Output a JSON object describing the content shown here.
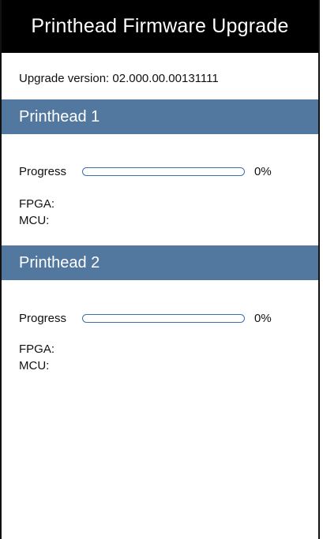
{
  "window": {
    "title": "Printhead Firmware Upgrade"
  },
  "upgrade": {
    "version_text": "Upgrade version: 02.000.00.00131111"
  },
  "printheads": [
    {
      "title": "Printhead 1",
      "progress_label": "Progress",
      "progress_value": 0,
      "progress_text": "0%",
      "fpga_label": "FPGA:",
      "mcu_label": "MCU:"
    },
    {
      "title": "Printhead 2",
      "progress_label": "Progress",
      "progress_value": 0,
      "progress_text": "0%",
      "fpga_label": "FPGA:",
      "mcu_label": "MCU:"
    }
  ],
  "colors": {
    "title_bar_bg": "#000000",
    "section_header_bg": "#5278a0",
    "progress_border": "#3f6fa8"
  }
}
